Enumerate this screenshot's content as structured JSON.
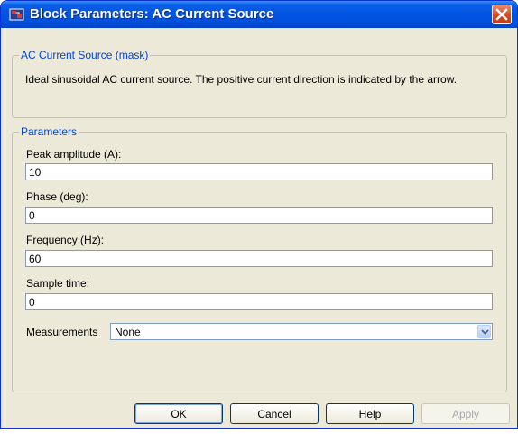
{
  "window": {
    "title": "Block Parameters: AC Current Source"
  },
  "mask": {
    "legend": "AC Current Source (mask)",
    "description": "Ideal sinusoidal AC current source. The positive current direction is indicated by the arrow."
  },
  "parameters": {
    "legend": "Parameters",
    "peak_amplitude": {
      "label": "Peak amplitude (A):",
      "value": "10"
    },
    "phase": {
      "label": "Phase (deg):",
      "value": "0"
    },
    "frequency": {
      "label": "Frequency (Hz):",
      "value": "60"
    },
    "sample_time": {
      "label": "Sample time:",
      "value": "0"
    },
    "measurements": {
      "label": "Measurements",
      "selected": "None"
    }
  },
  "buttons": {
    "ok": "OK",
    "cancel": "Cancel",
    "help": "Help",
    "apply": "Apply"
  },
  "icons": {
    "title": "simulink-block-icon",
    "close": "close-icon",
    "dropdown": "chevron-down-icon"
  },
  "colors": {
    "titlebar": "#0054e3",
    "close_button": "#d6491f",
    "dialog_background": "#ece9d8",
    "legend_text": "#0046d5"
  }
}
